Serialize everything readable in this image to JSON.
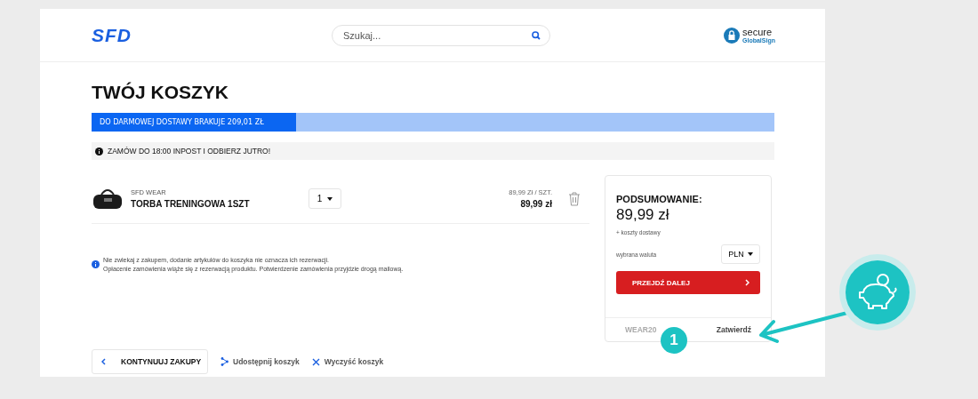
{
  "header": {
    "logo": "SFD",
    "search": {
      "placeholder": "Szukaj..."
    },
    "badge": {
      "title": "secure",
      "subtitle": "GlobalSign"
    }
  },
  "title": "TWÓJ KOSZYK",
  "shipping_bar": {
    "label": "DO DARMOWEJ DOSTAWY BRAKUJE 209,01 ZŁ",
    "level": 0.3
  },
  "notice": "ZAMÓW DO 18:00 INPOST I ODBIERZ JUTRO!",
  "items": [
    {
      "brand": "SFD WEAR",
      "name": "TORBA TRENINGOWA 1SZT",
      "quantity": "1",
      "unit_price": "89,99 Zł / SZT.",
      "total": "89,99 zł"
    }
  ],
  "info": [
    "Nie zwlekaj z zakupem, dodanie artykułów do koszyka nie oznacza ich rezerwacji.",
    "Opłacenie zamówienia wiąże się z rezerwacją produktu. Potwierdzenie zamówienia przyjdzie drogą mailową."
  ],
  "continue_button": "KONTYNUUJ ZAKUPY",
  "actions": [
    {
      "kind": "share",
      "label": "Udostępnij koszyk"
    },
    {
      "kind": "clear",
      "label": "Wyczyść koszyk"
    }
  ],
  "summary": {
    "title": "PODSUMOWANIE:",
    "total": "89,99 zł",
    "shipping_note": "+ koszty dostawy",
    "currency_label": "wybrana waluta",
    "currency": "PLN",
    "proceed_button": "PRZEJDŹ DALEJ",
    "coupon": {
      "value": "WEAR20",
      "apply": "Zatwierdź"
    }
  },
  "annotation": {
    "step": "1"
  }
}
